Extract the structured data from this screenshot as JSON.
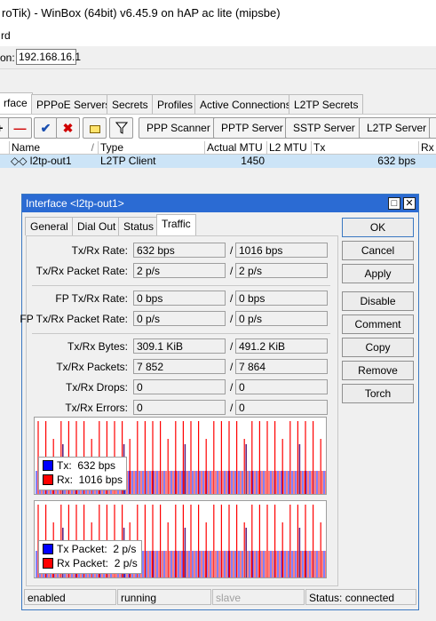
{
  "window": {
    "title": "roTik) - WinBox (64bit) v6.45.9 on hAP ac lite (mipsbe)",
    "menu": "rd",
    "address_label": "on:",
    "address_value": "192.168.16.1"
  },
  "tabs": [
    "rface",
    "PPPoE Servers",
    "Secrets",
    "Profiles",
    "Active Connections",
    "L2TP Secrets"
  ],
  "toolbar": {
    "buttons": [
      "PPP Scanner",
      "PPTP Server",
      "SSTP Server",
      "L2TP Server"
    ]
  },
  "table": {
    "columns": [
      "Name",
      "Type",
      "Actual MTU",
      "L2 MTU",
      "Tx",
      "Rx"
    ],
    "rows": [
      {
        "name": "◇◇ l2tp-out1",
        "type": "L2TP Client",
        "actual_mtu": "1450",
        "l2_mtu": "",
        "tx": "632 bps",
        "rx": ""
      }
    ]
  },
  "dialog": {
    "title": "Interface <l2tp-out1>",
    "tabs": [
      "General",
      "Dial Out",
      "Status",
      "Traffic"
    ],
    "active_tab": "Traffic",
    "fields": [
      {
        "label": "Tx/Rx Rate:",
        "tx": "632 bps",
        "rx": "1016 bps"
      },
      {
        "label": "Tx/Rx Packet Rate:",
        "tx": "2 p/s",
        "rx": "2 p/s"
      },
      {
        "label": "FP Tx/Rx Rate:",
        "tx": "0 bps",
        "rx": "0 bps"
      },
      {
        "label": "FP Tx/Rx Packet Rate:",
        "tx": "0 p/s",
        "rx": "0 p/s"
      },
      {
        "label": "Tx/Rx Bytes:",
        "tx": "309.1 KiB",
        "rx": "491.2 KiB"
      },
      {
        "label": "Tx/Rx Packets:",
        "tx": "7 852",
        "rx": "7 864"
      },
      {
        "label": "Tx/Rx Drops:",
        "tx": "0",
        "rx": "0"
      },
      {
        "label": "Tx/Rx Errors:",
        "tx": "0",
        "rx": "0"
      }
    ],
    "graph1_legend": [
      {
        "label": "Tx:",
        "value": "632 bps",
        "color": "#0000ff"
      },
      {
        "label": "Rx:",
        "value": "1016 bps",
        "color": "#ff0000"
      }
    ],
    "graph2_legend": [
      {
        "label": "Tx Packet:",
        "value": "2 p/s",
        "color": "#0000ff"
      },
      {
        "label": "Rx Packet:",
        "value": "2 p/s",
        "color": "#ff0000"
      }
    ],
    "buttons": [
      "OK",
      "Cancel",
      "Apply",
      "Disable",
      "Comment",
      "Copy",
      "Remove",
      "Torch"
    ],
    "status": [
      "enabled",
      "running",
      "slave",
      "Status: connected"
    ]
  },
  "colors": {
    "tx": "#0000ff",
    "rx": "#ff0000",
    "selected_row": "#cce4f7",
    "dialog_title": "#2b6bd3"
  }
}
